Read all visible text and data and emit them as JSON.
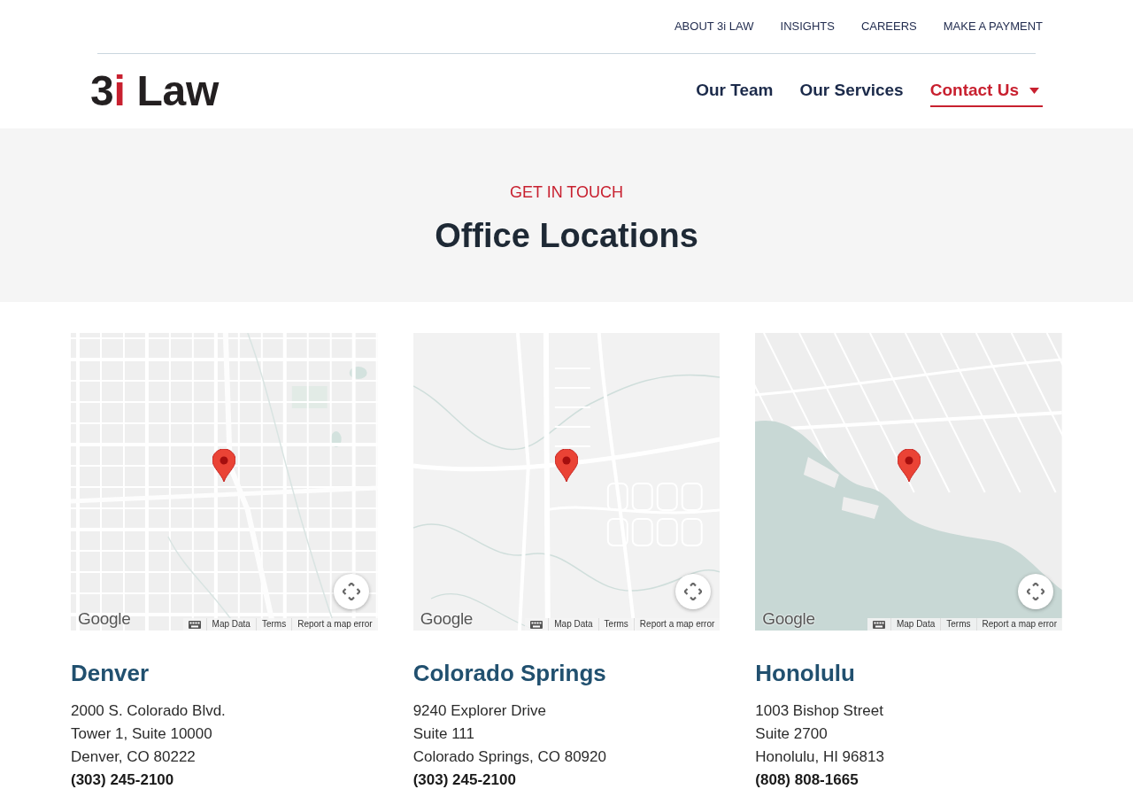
{
  "top_links": [
    "ABOUT 3i LAW",
    "INSIGHTS",
    "CAREERS",
    "MAKE A PAYMENT"
  ],
  "logo": {
    "prefix": "3",
    "accent": "i",
    "suffix": "Law"
  },
  "main_nav": [
    {
      "label": "Our Team",
      "selected": false,
      "dropdown": false
    },
    {
      "label": "Our Services",
      "selected": false,
      "dropdown": false
    },
    {
      "label": "Contact Us",
      "selected": true,
      "dropdown": true
    }
  ],
  "hero": {
    "eyebrow": "GET IN TOUCH",
    "title": "Office Locations"
  },
  "offices": [
    {
      "map": {
        "kind": "grid",
        "provider": "Google",
        "attribution": [
          "Map Data",
          "Terms",
          "Report a map error"
        ]
      },
      "city": "Denver",
      "address": [
        "2000 S. Colorado Blvd.",
        "Tower 1, Suite 10000",
        "Denver, CO 80222"
      ],
      "phone": "(303) 245-2100"
    },
    {
      "map": {
        "kind": "suburb",
        "provider": "Google",
        "attribution": [
          "Map Data",
          "Terms",
          "Report a map error"
        ]
      },
      "city": "Colorado Springs",
      "address": [
        "9240 Explorer Drive",
        "Suite 111",
        "Colorado Springs, CO 80920"
      ],
      "phone": "(303) 245-2100"
    },
    {
      "map": {
        "kind": "coast",
        "provider": "Google",
        "attribution": [
          "Map Data",
          "Terms",
          "Report a map error"
        ]
      },
      "city": "Honolulu",
      "address": [
        "1003 Bishop Street",
        "Suite 2700",
        "Honolulu, HI 96813"
      ],
      "phone": "(808) 808-1665"
    }
  ]
}
